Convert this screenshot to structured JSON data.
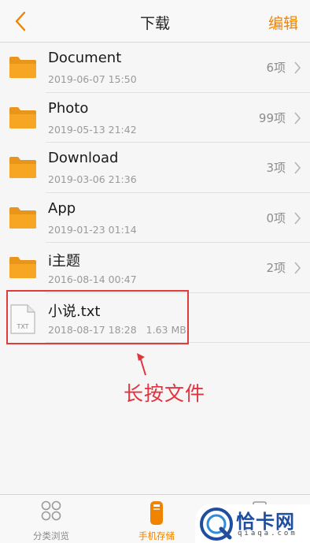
{
  "header": {
    "title": "下载",
    "back_icon": "chevron-left-icon",
    "edit_label": "编辑"
  },
  "colors": {
    "accent": "#f08300",
    "folder": "#f6a623",
    "annotation": "#e0353f",
    "watermark_blue": "#1f4e9e"
  },
  "folders": [
    {
      "name": "Document",
      "date": "2019-06-07 15:50",
      "count": "6项"
    },
    {
      "name": "Photo",
      "date": "2019-05-13 21:42",
      "count": "99项"
    },
    {
      "name": "Download",
      "date": "2019-03-06 21:36",
      "count": "3项"
    },
    {
      "name": "App",
      "date": "2019-01-23 01:14",
      "count": "0项"
    },
    {
      "name": "i主题",
      "date": "2016-08-14 00:47",
      "count": "2项"
    }
  ],
  "file": {
    "name": "小说.txt",
    "date": "2018-08-17 18:28",
    "size": "1.63 MB",
    "icon_label": "TXT"
  },
  "annotation": {
    "text": "长按文件"
  },
  "tabs": [
    {
      "label": "分类浏览",
      "icon": "grid-icon"
    },
    {
      "label": "手机存储",
      "icon": "phone-storage-icon"
    },
    {
      "label": "",
      "icon": "document-icon"
    }
  ],
  "watermark": {
    "brand": "恰卡网",
    "domain": "qiaqa.com"
  }
}
